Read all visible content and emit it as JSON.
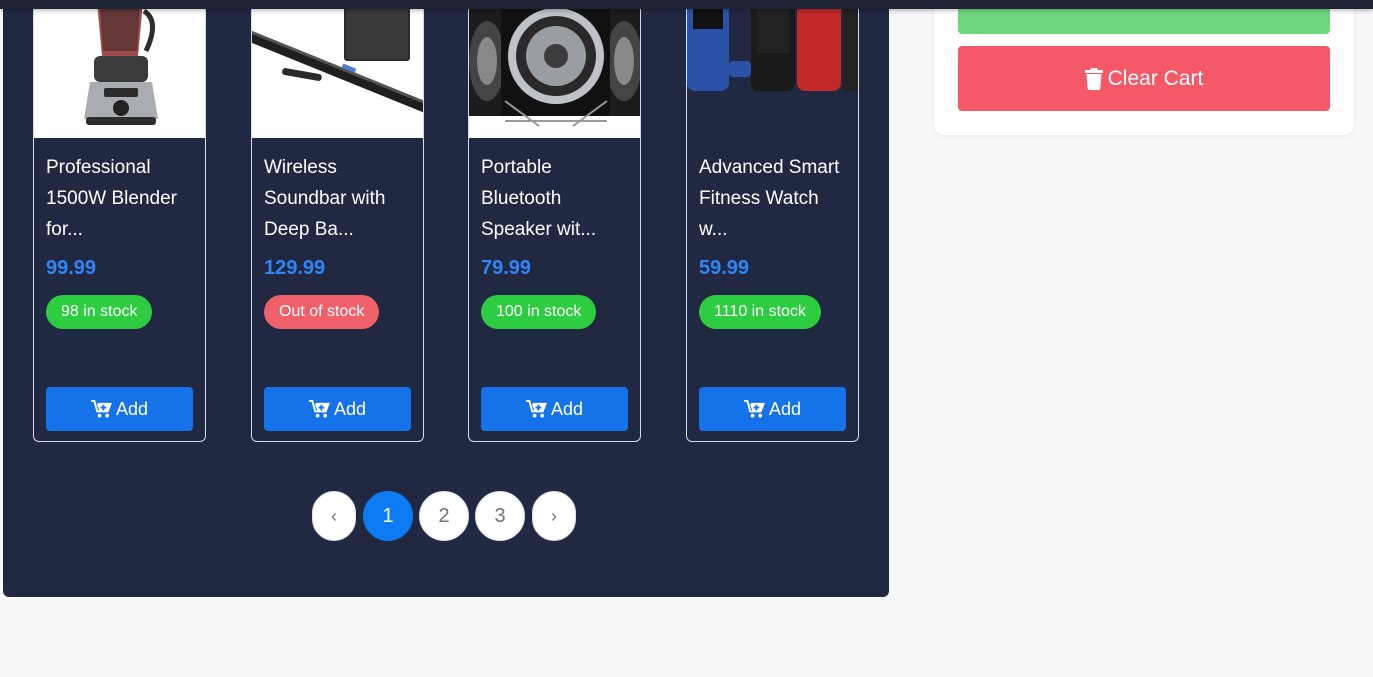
{
  "products": [
    {
      "title": "Professional 1500W Blender for...",
      "price": "99.99",
      "stock": "98 in stock",
      "stock_status": "in",
      "add_label": "Add",
      "image": "blender-icon"
    },
    {
      "title": "Wireless Soundbar with Deep Ba...",
      "price": "129.99",
      "stock": "Out of stock",
      "stock_status": "out",
      "add_label": "Add",
      "image": "soundbar-icon"
    },
    {
      "title": "Portable Bluetooth Speaker wit...",
      "price": "79.99",
      "stock": "100 in stock",
      "stock_status": "in",
      "add_label": "Add",
      "image": "speaker-icon"
    },
    {
      "title": "Advanced Smart Fitness Watch w...",
      "price": "59.99",
      "stock": "1110 in stock",
      "stock_status": "in",
      "add_label": "Add",
      "image": "fitness-watch-icon"
    }
  ],
  "pagination": {
    "prev": "‹",
    "pages": [
      "1",
      "2",
      "3"
    ],
    "active": "1",
    "next": "›"
  },
  "cart": {
    "clear_label": "Clear Cart"
  },
  "colors": {
    "panel_bg": "#212842",
    "price": "#2f86f6",
    "in_stock": "#2ecc40",
    "out_of_stock": "#f0606b",
    "add_button": "#1572e8",
    "clear_button": "#f35966",
    "checkout_button": "#6dd77d",
    "active_page": "#0d7cf2"
  }
}
